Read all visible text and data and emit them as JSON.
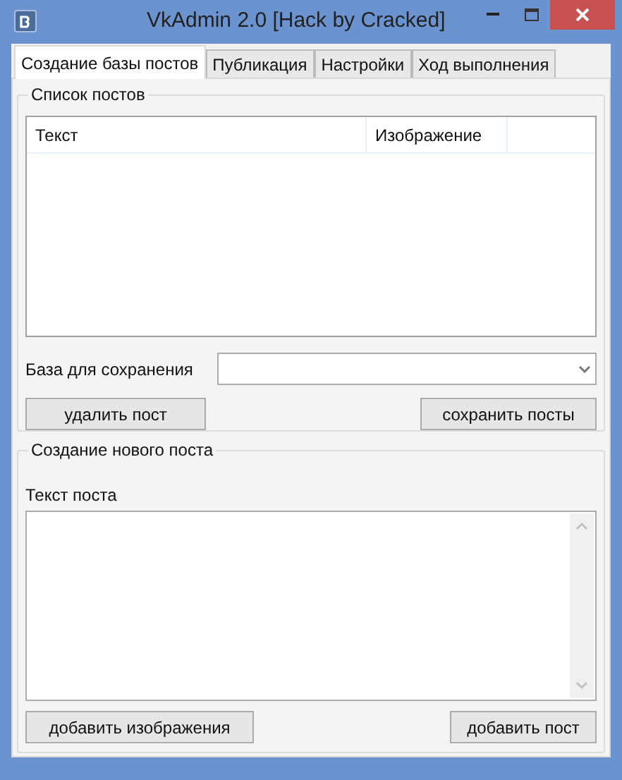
{
  "window": {
    "title": "VkAdmin 2.0 [Hack by Cracked]"
  },
  "tabs": [
    {
      "label": "Создание базы постов",
      "selected": true
    },
    {
      "label": "Публикация",
      "selected": false
    },
    {
      "label": "Настройки",
      "selected": false
    },
    {
      "label": "Ход выполнения",
      "selected": false
    }
  ],
  "posts_group": {
    "title": "Список постов",
    "table": {
      "columns": [
        "Текст",
        "Изображение"
      ]
    },
    "save_base_label": "База для сохранения",
    "buttons": [
      "удалить пост",
      "сохранить посты"
    ]
  },
  "new_post_group": {
    "title": "Создание нового поста",
    "text_label": "Текст поста",
    "buttons": [
      "добавить изображения",
      "добавить пост"
    ]
  }
}
